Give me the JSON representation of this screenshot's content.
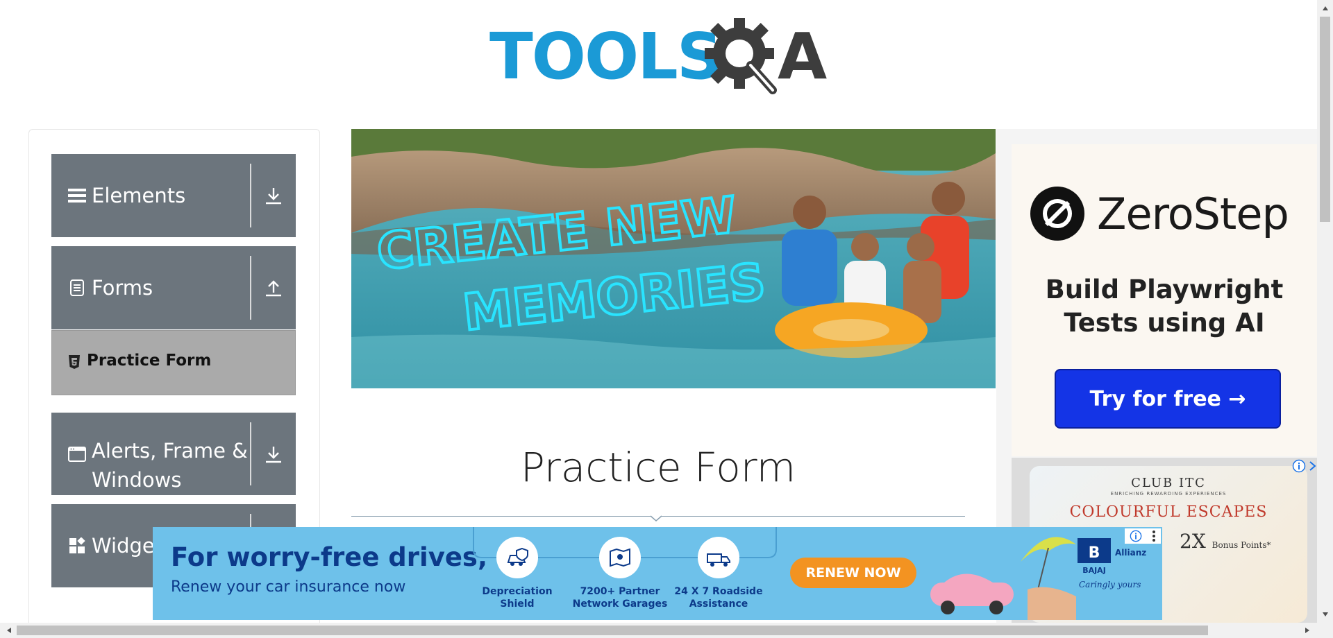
{
  "header": {
    "logo_text": "TOOLS",
    "logo_letter": "A"
  },
  "menu": {
    "elements": {
      "label": "Elements"
    },
    "forms": {
      "label": "Forms"
    },
    "practice_form": {
      "label": "Practice Form"
    },
    "alerts": {
      "label_line1": "Alerts, Frame &",
      "label_line2": "Windows"
    },
    "widgets": {
      "label": "Widgets"
    }
  },
  "banner": {
    "line1": "CREATE NEW",
    "line2": "MEMORIES"
  },
  "main": {
    "title": "Practice Form"
  },
  "right_ad": {
    "brand": "ZeroStep",
    "tagline_line1": "Build Playwright",
    "tagline_line2": "Tests using AI",
    "cta": "Try for free →"
  },
  "club_ad": {
    "brand": "CLUB ITC",
    "subtitle": "ENRICHING REWARDING EXPERIENCES",
    "title": "COLOURFUL ESCAPES",
    "points_big": "2X",
    "points_small": "Bonus Points*"
  },
  "bottom_ad": {
    "line1": "For worry-free drives,",
    "line2": "Renew your car insurance now",
    "features": [
      {
        "line1": "Depreciation",
        "line2": "Shield"
      },
      {
        "line1": "7200+ Partner",
        "line2": "Network Garages"
      },
      {
        "line1": "24 X 7 Roadside",
        "line2": "Assistance"
      }
    ],
    "cta": "RENEW NOW",
    "brand": "BAJAJ",
    "partner": "Allianz",
    "slogan": "Caringly yours"
  },
  "colors": {
    "menu_bg": "#6c757d",
    "sub_item_bg": "#aaaaaa",
    "logo_blue": "#1b9ad6",
    "cta_blue": "#1434e6",
    "renew_orange": "#f39321"
  }
}
